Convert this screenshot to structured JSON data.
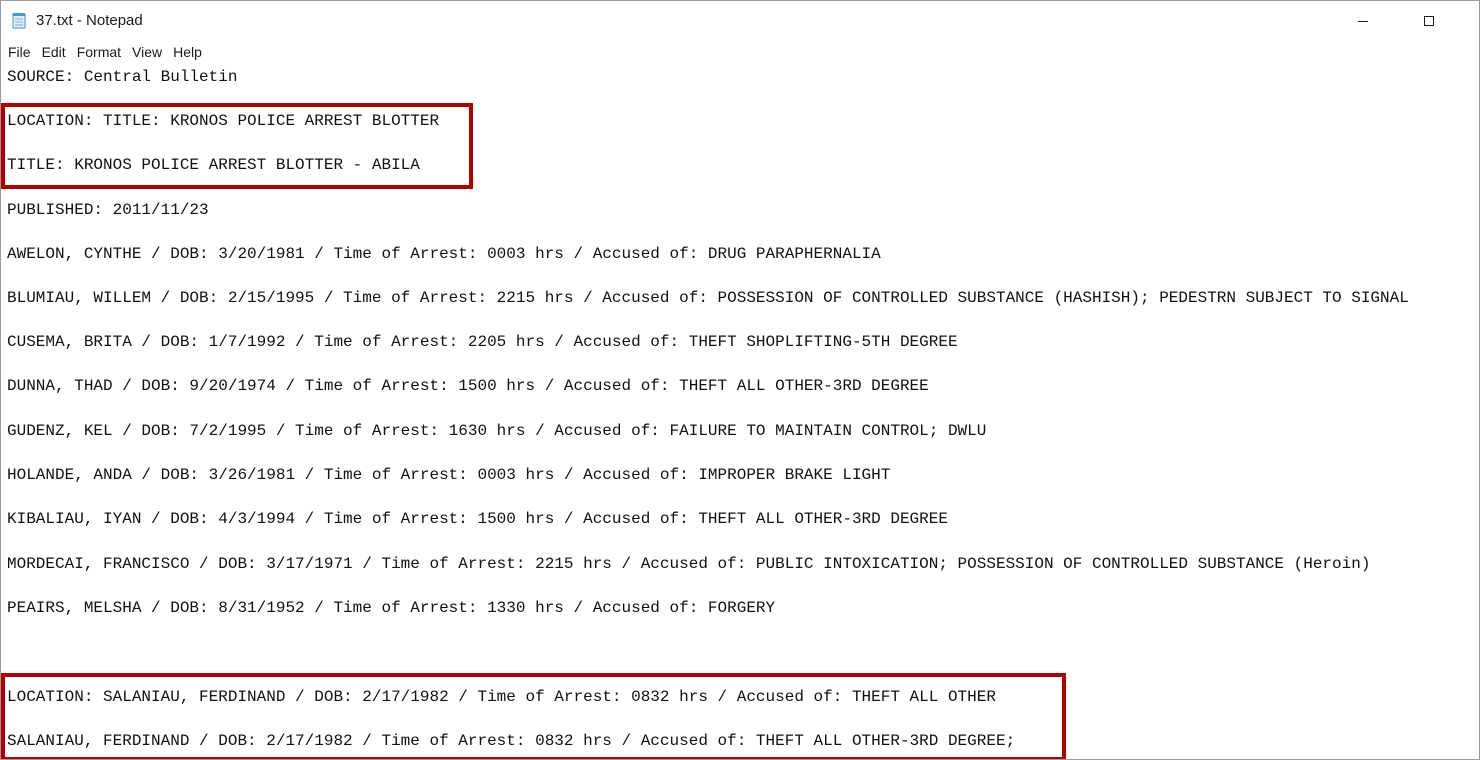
{
  "window": {
    "title": "37.txt - Notepad",
    "app_icon": "notepad-icon"
  },
  "menu": [
    "File",
    "Edit",
    "Format",
    "View",
    "Help"
  ],
  "lines": [
    "SOURCE: Central Bulletin",
    "LOCATION: TITLE: KRONOS POLICE ARREST BLOTTER",
    "TITLE: KRONOS POLICE ARREST BLOTTER - ABILA",
    "PUBLISHED: 2011/11/23",
    "AWELON, CYNTHE / DOB: 3/20/1981 / Time of Arrest: 0003 hrs / Accused of: DRUG PARAPHERNALIA",
    "BLUMIAU, WILLEM / DOB: 2/15/1995 / Time of Arrest: 2215 hrs / Accused of: POSSESSION OF CONTROLLED SUBSTANCE (HASHISH); PEDESTRN SUBJECT TO SIGNAL",
    "CUSEMA, BRITA / DOB: 1/7/1992 / Time of Arrest: 2205 hrs / Accused of: THEFT SHOPLIFTING-5TH DEGREE",
    "DUNNA, THAD / DOB: 9/20/1974 / Time of Arrest: 1500 hrs / Accused of: THEFT ALL OTHER-3RD DEGREE",
    "GUDENZ, KEL / DOB: 7/2/1995 / Time of Arrest: 1630 hrs / Accused of: FAILURE TO MAINTAIN CONTROL; DWLU",
    "HOLANDE, ANDA / DOB: 3/26/1981 / Time of Arrest: 0003 hrs / Accused of: IMPROPER BRAKE LIGHT",
    "KIBALIAU, IYAN / DOB: 4/3/1994 / Time of Arrest: 1500 hrs / Accused of: THEFT ALL OTHER-3RD DEGREE",
    "MORDECAI, FRANCISCO / DOB: 3/17/1971 / Time of Arrest: 2215 hrs / Accused of: PUBLIC INTOXICATION; POSSESSION OF CONTROLLED SUBSTANCE (Heroin)",
    "PEAIRS, MELSHA / DOB: 8/31/1952 / Time of Arrest: 1330 hrs / Accused of: FORGERY",
    "LOCATION: SALANIAU, FERDINAND / DOB: 2/17/1982 / Time of Arrest: 0832 hrs / Accused of: THEFT ALL OTHER",
    "SALANIAU, FERDINAND / DOB: 2/17/1982 / Time of Arrest: 0832 hrs / Accused of: THEFT ALL OTHER-3RD DEGREE;"
  ],
  "colors": {
    "highlight": "#b40000"
  }
}
